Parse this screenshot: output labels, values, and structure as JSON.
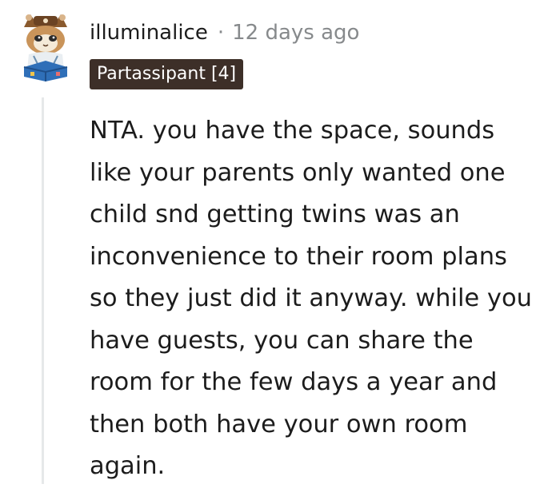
{
  "comment": {
    "username": "illuminalice",
    "separator": "·",
    "timestamp": "12 days ago",
    "flair": "Partassipant [4]",
    "body": "NTA. you have the space, sounds\nlike your parents only wanted one\nchild snd getting twins was an\ninconvenience to their room plans\nso they just did it anyway. while you\nhave guests, you can share the\nroom for the few days a year and\nthen both have your own room\nagain."
  },
  "icons": {
    "avatar": "cat-avatar-icon"
  },
  "colors": {
    "flair_background": "#3d2f28",
    "flair_text": "#ffffff",
    "meta_text": "#878a8c",
    "body_text": "#1c1c1c",
    "thread_line": "#e6e8e9"
  }
}
